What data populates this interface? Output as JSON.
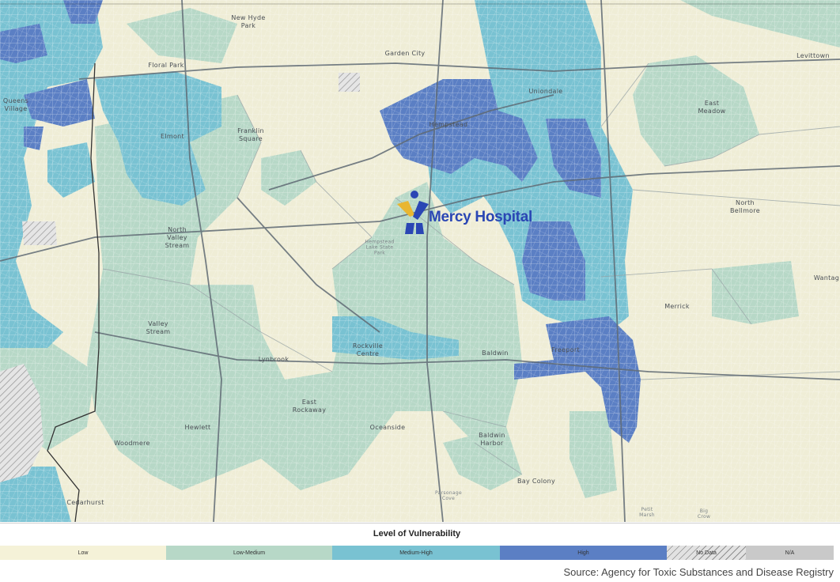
{
  "map": {
    "place_labels": [
      {
        "id": "new-hyde-park",
        "text": "New Hyde\nPark"
      },
      {
        "id": "garden-city",
        "text": "Garden City"
      },
      {
        "id": "levittown",
        "text": "Levittown"
      },
      {
        "id": "floral-park",
        "text": "Floral Park"
      },
      {
        "id": "uniondale",
        "text": "Uniondale"
      },
      {
        "id": "queens-village",
        "text": "Queens\nVillage"
      },
      {
        "id": "hempstead",
        "text": "Hempstead"
      },
      {
        "id": "east-meadow",
        "text": "East\nMeadow"
      },
      {
        "id": "franklin-square",
        "text": "Franklin\nSquare"
      },
      {
        "id": "elmont",
        "text": "Elmont"
      },
      {
        "id": "north-bellmore",
        "text": "North\nBellmore"
      },
      {
        "id": "north-valley-stream",
        "text": "North\nValley\nStream"
      },
      {
        "id": "wantagh",
        "text": "Wantag"
      },
      {
        "id": "merrick",
        "text": "Merrick"
      },
      {
        "id": "valley-stream",
        "text": "Valley\nStream"
      },
      {
        "id": "rockville-centre",
        "text": "Rockville\nCentre"
      },
      {
        "id": "baldwin",
        "text": "Baldwin"
      },
      {
        "id": "freeport",
        "text": "Freeport"
      },
      {
        "id": "lynbrook",
        "text": "Lynbrook"
      },
      {
        "id": "east-rockaway",
        "text": "East\nRockaway"
      },
      {
        "id": "hewlett",
        "text": "Hewlett"
      },
      {
        "id": "oceanside",
        "text": "Oceanside"
      },
      {
        "id": "baldwin-harbor",
        "text": "Baldwin\nHarbor"
      },
      {
        "id": "woodmere",
        "text": "Woodmere"
      },
      {
        "id": "bay-colony",
        "text": "Bay Colony"
      },
      {
        "id": "cedarhurst",
        "text": "Cedarhurst"
      }
    ],
    "minor_labels": [
      {
        "id": "hempstead-lake-state-park",
        "text": "Hempstead\nLake State\nPark"
      },
      {
        "id": "parsonage-cove",
        "text": "Parsonage\nCove"
      },
      {
        "id": "petit-marsh",
        "text": "Petit\nMarsh"
      },
      {
        "id": "big-crow",
        "text": "Big\nCrow"
      }
    ],
    "hospital": {
      "name": "Mercy Hospital",
      "logo_colors": {
        "gold": "#e8b631",
        "blue": "#2a46b4"
      }
    }
  },
  "legend": {
    "title": "Level of Vulnerability",
    "items": [
      {
        "label": "Low",
        "color": "#f5f2d8"
      },
      {
        "label": "Low-Medium",
        "color": "#b7d8c7"
      },
      {
        "label": "Medium-High",
        "color": "#79c2d2"
      },
      {
        "label": "High",
        "color": "#5b7fc4"
      },
      {
        "label": "No Data",
        "color": "#e2e2e2"
      },
      {
        "label": "N/A",
        "color": "#c9c9c9"
      }
    ]
  },
  "source": "Source: Agency for Toxic Substances and Disease Registry",
  "colors": {
    "low": "#efedd6",
    "low_medium": "#b7d8c7",
    "medium_high": "#79c2d2",
    "high": "#5b7fc4",
    "road": "#64707c",
    "street": "#ffffff"
  }
}
